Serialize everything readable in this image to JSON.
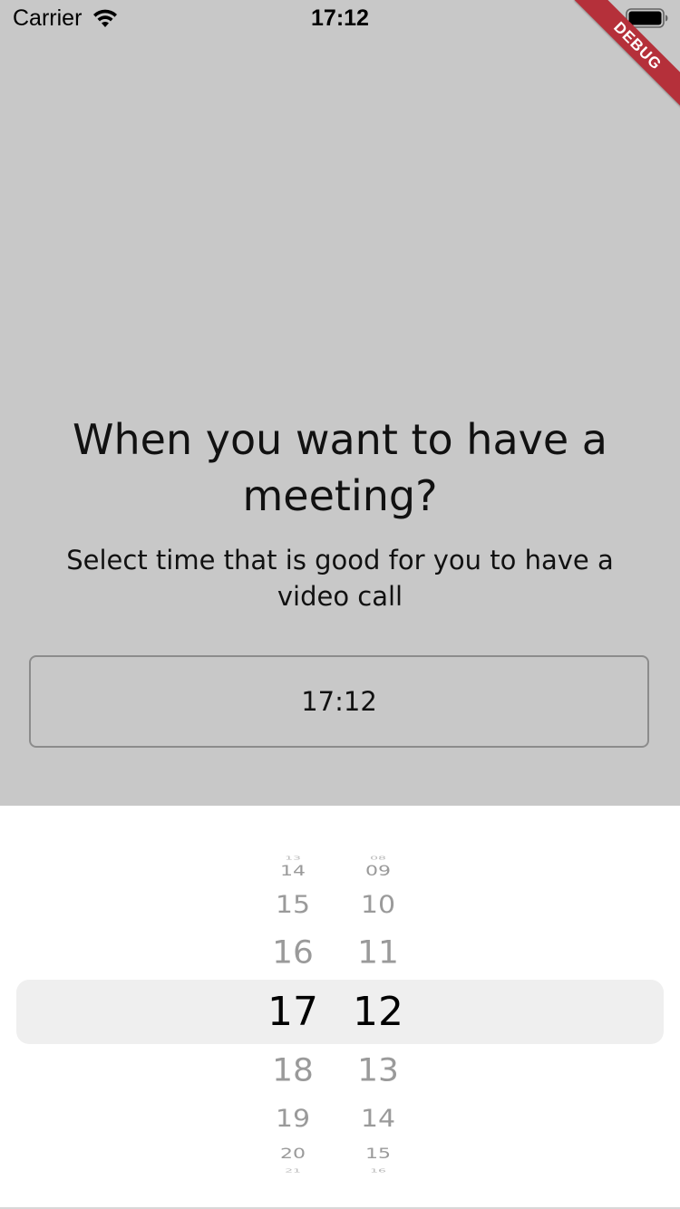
{
  "status_bar": {
    "carrier": "Carrier",
    "time": "17:12",
    "icons": [
      "wifi-icon",
      "battery-icon"
    ]
  },
  "debug_banner": "DEBUG",
  "main": {
    "title": "When you want to have a meeting?",
    "subtitle": "Select time that is good for you to have a video call",
    "time_value": "17:12"
  },
  "picker": {
    "hours": [
      "13",
      "14",
      "15",
      "16",
      "17",
      "18",
      "19",
      "20",
      "21"
    ],
    "minutes": [
      "08",
      "09",
      "10",
      "11",
      "12",
      "13",
      "14",
      "15",
      "16"
    ],
    "selected_hour": "17",
    "selected_minute": "12"
  },
  "colors": {
    "background": "#c8c8c8",
    "sheet": "#ffffff",
    "selection_band": "#efefef",
    "debug_banner": "#b5303a",
    "unselected_text": "#9a9a9a"
  }
}
